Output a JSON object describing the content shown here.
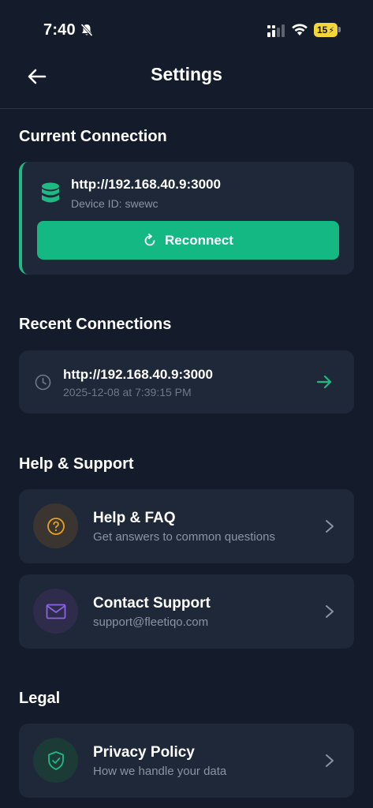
{
  "status_bar": {
    "time": "7:40",
    "battery": "15"
  },
  "header": {
    "title": "Settings"
  },
  "current_connection": {
    "section_title": "Current Connection",
    "url": "http://192.168.40.9:3000",
    "device_id": "Device ID: swewc",
    "reconnect_label": "Reconnect"
  },
  "recent_connections": {
    "section_title": "Recent Connections",
    "items": [
      {
        "url": "http://192.168.40.9:3000",
        "timestamp": "2025-12-08 at 7:39:15 PM"
      }
    ]
  },
  "help_support": {
    "section_title": "Help & Support",
    "items": [
      {
        "title": "Help & FAQ",
        "subtitle": "Get answers to common questions",
        "icon": "question-icon"
      },
      {
        "title": "Contact Support",
        "subtitle": "support@fleetiqo.com",
        "icon": "mail-icon"
      }
    ]
  },
  "legal": {
    "section_title": "Legal",
    "items": [
      {
        "title": "Privacy Policy",
        "subtitle": "How we handle your data",
        "icon": "shield-check-icon"
      }
    ]
  },
  "colors": {
    "background": "#141c2b",
    "card": "#1e2838",
    "accent_green": "#14b883",
    "help_orange": "#e8a21a",
    "support_purple": "#8a63e6"
  }
}
